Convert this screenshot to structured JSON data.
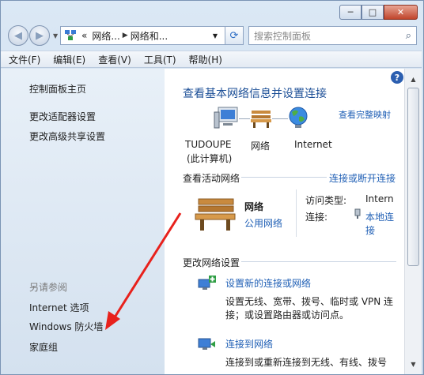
{
  "window": {
    "minimize": "─",
    "maximize": "□",
    "close": "✕"
  },
  "address_bar": {
    "prefix": "«",
    "crumbs": [
      "网络...",
      "网络和..."
    ],
    "refresh": "⟳"
  },
  "search": {
    "placeholder": "搜索控制面板"
  },
  "menu": [
    "文件(F)",
    "编辑(E)",
    "查看(V)",
    "工具(T)",
    "帮助(H)"
  ],
  "sidebar": {
    "items": [
      "控制面板主页",
      "更改适配器设置",
      "更改高级共享设置"
    ],
    "see_also_header": "另请参阅",
    "see_also": [
      "Internet 选项",
      "Windows 防火墙",
      "家庭组"
    ]
  },
  "main": {
    "title": "查看基本网络信息并设置连接",
    "full_map_link": "查看完整映射",
    "map_nodes": [
      {
        "label": "TUDOUPE",
        "sublabel": "(此计算机)",
        "icon": "computer-icon"
      },
      {
        "label": "网络",
        "sublabel": "",
        "icon": "bench-icon"
      },
      {
        "label": "Internet",
        "sublabel": "",
        "icon": "globe-icon"
      }
    ],
    "active_networks_label": "查看活动网络",
    "connect_disconnect_link": "连接或断开连接",
    "network": {
      "name": "网络",
      "type_link": "公用网络",
      "access_type_label": "访问类型:",
      "access_type_value": "Interne",
      "connection_label": "连接:",
      "connection_value_line1": "本地连",
      "connection_value_line2": "接"
    },
    "change_settings_label": "更改网络设置",
    "tasks": [
      {
        "title": "设置新的连接或网络",
        "desc_line1": "设置无线、宽带、拨号、临时或 VPN 连",
        "desc_line2": "接；或设置路由器或访问点。",
        "icon": "new-connection-icon"
      },
      {
        "title": "连接到网络",
        "desc_line1": "连接到或重新连接到无线、有线、拨号",
        "icon": "connect-network-icon"
      }
    ]
  },
  "colors": {
    "link": "#1f5fb5",
    "title": "#1b4e96",
    "sidebar_bg": "#dce7f3",
    "arrow": "#e8211c"
  }
}
